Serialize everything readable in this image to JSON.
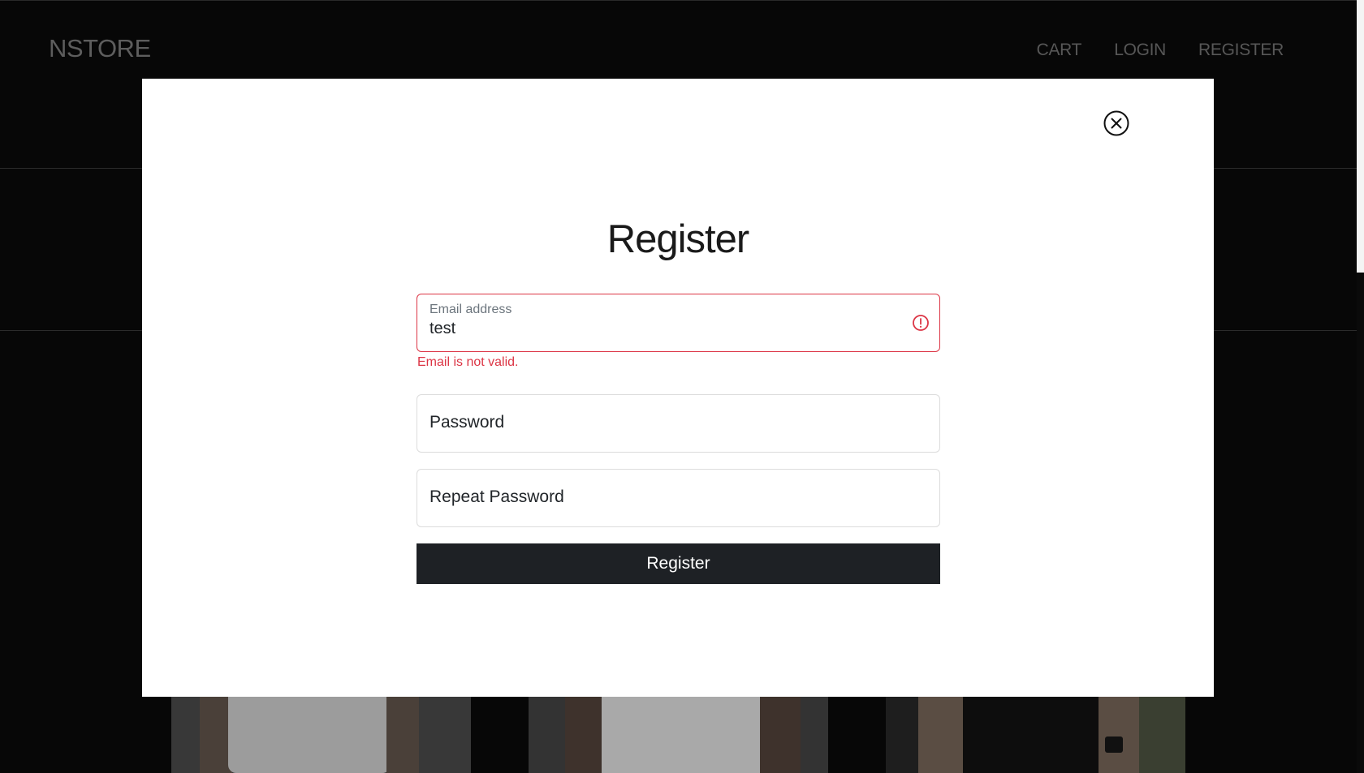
{
  "header": {
    "brand": "NSTORE",
    "nav": [
      {
        "label": "CART"
      },
      {
        "label": "LOGIN"
      },
      {
        "label": "REGISTER"
      }
    ]
  },
  "modal": {
    "title": "Register",
    "close_icon": "close-circle-icon",
    "fields": {
      "email": {
        "label": "Email address",
        "value": "test",
        "error": "Email is not valid.",
        "error_icon": "exclamation-circle-icon"
      },
      "password": {
        "placeholder": "Password"
      },
      "repeat_password": {
        "placeholder": "Repeat Password"
      }
    },
    "submit_label": "Register"
  },
  "colors": {
    "error": "#dc3545",
    "button_bg": "#1e2125",
    "page_bg": "#070707"
  }
}
